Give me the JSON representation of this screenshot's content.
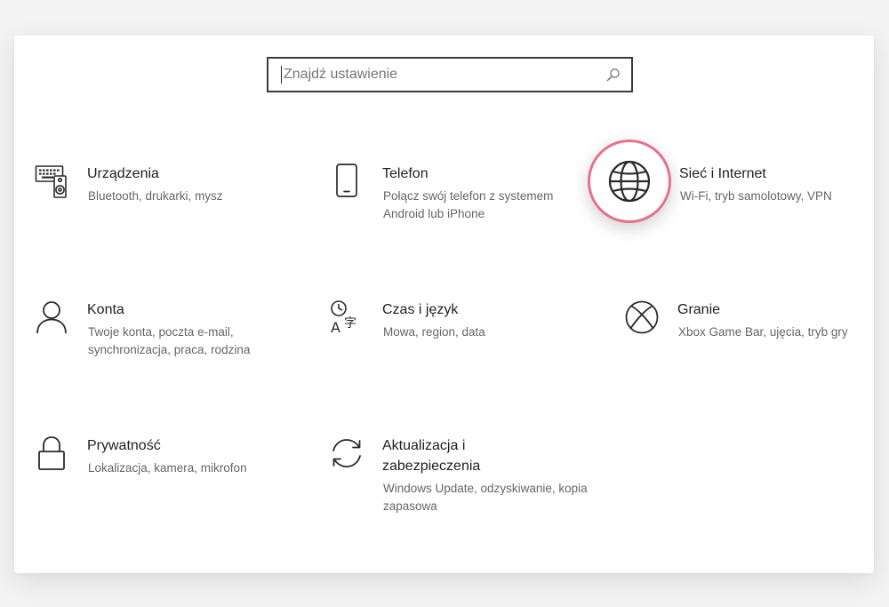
{
  "search": {
    "placeholder": "Znajdź ustawienie"
  },
  "accent_color": "#e8708a",
  "tiles": [
    {
      "icon": "keyboard-speaker-icon",
      "title": "Urządzenia",
      "desc": "Bluetooth, drukarki, mysz"
    },
    {
      "icon": "phone-icon",
      "title": "Telefon",
      "desc": "Połącz swój telefon z systemem Android lub iPhone"
    },
    {
      "icon": "globe-icon",
      "title": "Sieć i Internet",
      "desc": "Wi-Fi, tryb samolotowy, VPN"
    },
    {
      "icon": "person-icon",
      "title": "Konta",
      "desc": "Twoje konta, poczta e-mail, synchronizacja, praca, rodzina"
    },
    {
      "icon": "time-language-icon",
      "title": "Czas i język",
      "desc": "Mowa, region, data"
    },
    {
      "icon": "xbox-icon",
      "title": "Granie",
      "desc": "Xbox Game Bar, ujęcia, tryb gry"
    },
    {
      "icon": "lock-icon",
      "title": "Prywatność",
      "desc": "Lokalizacja, kamera, mikrofon"
    },
    {
      "icon": "refresh-icon",
      "title": "Aktualizacja i zabezpieczenia",
      "desc": "Windows Update, odzyskiwanie, kopia zapasowa"
    }
  ]
}
